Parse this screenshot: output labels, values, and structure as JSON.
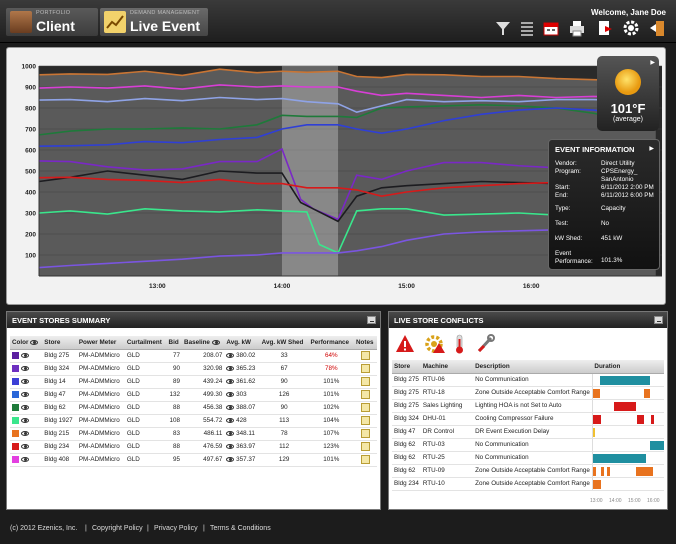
{
  "header": {
    "crumb1": {
      "small": "PORTFOLIO",
      "big": "Client"
    },
    "crumb2": {
      "small": "DEMAND MANAGEMENT",
      "big": "Live Event"
    },
    "welcome": "Welcome, Jane Doe",
    "tools": [
      "filter-icon",
      "table-icon",
      "calendar-icon",
      "print-icon",
      "export-icon",
      "gear-icon",
      "logout-icon"
    ]
  },
  "weather": {
    "temp": "101°F",
    "label": "(average)"
  },
  "event_info": {
    "title": "EVENT INFORMATION",
    "rows": [
      {
        "label": "Vendor:",
        "value": "Direct Utility"
      },
      {
        "label": "Program:",
        "value": "CPSEnergy_ SanAntonio"
      },
      {
        "label": "Start:",
        "value": "6/11/2012 2:00 PM"
      },
      {
        "label": "End:",
        "value": "6/11/2012 6:00 PM"
      },
      {
        "label": "Type:",
        "value": "Capacity"
      },
      {
        "label": "Test:",
        "value": "No"
      },
      {
        "label": "kW Shed:",
        "value": "451 kW"
      },
      {
        "label": "Event Performance:",
        "value": "101.3%"
      }
    ]
  },
  "chart_data": {
    "type": "line",
    "ylim": [
      0,
      1000
    ],
    "yticks": [
      "1000",
      "900",
      "800",
      "700",
      "600",
      "500",
      "400",
      "300",
      "200",
      "100"
    ],
    "xticks": [
      "13:00",
      "14:00",
      "15:00",
      "16:00"
    ],
    "xlim": [
      12.05,
      17.05
    ],
    "event_window": [
      14.0,
      14.45
    ],
    "series": [
      {
        "color": "#c97534",
        "x": [
          12.05,
          12.3,
          12.6,
          12.9,
          13.2,
          13.5,
          13.8,
          14.0,
          14.2,
          14.45,
          14.6,
          14.8,
          15.0,
          15.3,
          15.6,
          15.9,
          16.2,
          16.5,
          16.8,
          17.0
        ],
        "values": [
          958,
          962,
          960,
          975,
          955,
          985,
          968,
          975,
          970,
          975,
          950,
          945,
          960,
          958,
          950,
          950,
          940,
          935,
          930,
          935
        ]
      },
      {
        "color": "#d83fd6",
        "x": [
          12.05,
          12.3,
          12.6,
          12.9,
          13.2,
          13.5,
          13.8,
          14.0,
          14.2,
          14.45,
          14.6,
          14.8,
          15.0,
          15.3,
          15.6,
          15.9,
          16.2,
          16.5,
          16.8,
          17.0
        ],
        "values": [
          895,
          900,
          895,
          905,
          890,
          910,
          900,
          905,
          900,
          900,
          880,
          860,
          870,
          860,
          850,
          860,
          850,
          855,
          850,
          870
        ]
      },
      {
        "color": "#8fa3e6",
        "x": [
          12.05,
          12.3,
          12.6,
          12.9,
          13.2,
          13.5,
          13.8,
          14.0,
          14.2,
          14.45,
          14.6,
          14.8,
          15.0,
          15.3,
          15.6,
          15.9,
          16.2,
          16.5,
          16.8,
          17.0
        ],
        "values": [
          838,
          840,
          830,
          845,
          835,
          850,
          840,
          845,
          830,
          820,
          780,
          810,
          840,
          830,
          835,
          830,
          840,
          840,
          835,
          840
        ]
      },
      {
        "color": "#1e7a3a",
        "x": [
          12.05,
          12.3,
          12.6,
          12.9,
          13.2,
          13.5,
          13.8,
          14.0,
          14.2,
          14.45,
          14.6,
          14.8,
          15.0,
          15.3,
          15.6,
          15.9,
          16.2,
          16.5,
          16.8,
          17.0
        ],
        "values": [
          672,
          690,
          700,
          700,
          705,
          700,
          720,
          765,
          760,
          760,
          755,
          800,
          805,
          810,
          815,
          810,
          800,
          775,
          740,
          700
        ]
      },
      {
        "color": "#2f3fd6",
        "x": [
          12.05,
          12.3,
          12.6,
          12.9,
          13.2,
          13.5,
          13.8,
          14.0,
          14.2,
          14.45,
          14.6,
          14.8,
          15.0,
          15.3,
          15.6,
          15.9,
          16.2,
          16.5,
          16.8,
          17.0
        ],
        "values": [
          618,
          620,
          625,
          640,
          635,
          650,
          660,
          700,
          720,
          720,
          700,
          680,
          700,
          740,
          770,
          790,
          800,
          790,
          770,
          770
        ]
      },
      {
        "color": "#7a28c6",
        "x": [
          12.05,
          12.3,
          12.6,
          12.9,
          13.2,
          13.5,
          13.8,
          14.0,
          14.15,
          14.25,
          14.45,
          14.6,
          14.8,
          15.0,
          15.3,
          15.6,
          15.9,
          16.2,
          16.5,
          16.8,
          17.0
        ],
        "values": [
          548,
          545,
          520,
          505,
          510,
          545,
          545,
          605,
          365,
          320,
          270,
          480,
          460,
          500,
          540,
          540,
          525,
          515,
          510,
          500,
          520
        ]
      },
      {
        "color": "#1c1c20",
        "x": [
          12.05,
          12.3,
          12.6,
          12.9,
          13.2,
          13.5,
          13.8,
          14.0,
          14.15,
          14.25,
          14.45,
          14.6,
          14.8,
          15.0,
          15.3,
          15.6,
          15.9,
          16.2,
          16.5,
          16.8,
          17.0
        ],
        "values": [
          450,
          470,
          500,
          480,
          460,
          500,
          490,
          490,
          350,
          320,
          260,
          380,
          420,
          430,
          440,
          450,
          445,
          440,
          430,
          430,
          440
        ]
      },
      {
        "color": "#d71a1a",
        "x": [
          12.05,
          12.3,
          12.6,
          12.9,
          13.2,
          13.5,
          13.8,
          14.0,
          14.2,
          14.45,
          14.6,
          14.8,
          15.0,
          15.3,
          15.6,
          15.9,
          16.2,
          16.5,
          16.8,
          17.0
        ],
        "values": [
          468,
          470,
          460,
          455,
          445,
          460,
          440,
          440,
          420,
          420,
          410,
          380,
          400,
          420,
          430,
          440,
          445,
          440,
          430,
          420
        ]
      },
      {
        "color": "#3ae68c",
        "x": [
          12.05,
          12.3,
          12.6,
          12.9,
          13.2,
          13.5,
          13.8,
          14.0,
          14.2,
          14.3,
          14.45,
          14.6,
          14.8,
          15.0,
          15.3,
          15.6,
          15.9,
          16.2,
          16.5,
          16.8,
          17.0
        ],
        "values": [
          300,
          310,
          295,
          320,
          310,
          305,
          315,
          310,
          305,
          150,
          110,
          310,
          320,
          320,
          290,
          295,
          300,
          290,
          295,
          300,
          305
        ]
      },
      {
        "color": "#7a55e0",
        "x": [
          12.05,
          12.3,
          12.6,
          12.9,
          13.2,
          13.5,
          13.8,
          14.0,
          14.2,
          14.45,
          14.6,
          14.8,
          15.0,
          15.3,
          15.6,
          15.9,
          16.2,
          16.5,
          16.8,
          17.0
        ],
        "values": [
          40,
          50,
          60,
          70,
          80,
          95,
          100,
          110,
          110,
          110,
          120,
          140,
          170,
          200,
          210,
          215,
          220,
          215,
          220,
          235
        ]
      }
    ]
  },
  "event_stores": {
    "title": "EVENT STORES SUMMARY",
    "columns": [
      "Color",
      "Store",
      "Power Meter",
      "Curtailment",
      "Bid",
      "Baseline",
      "Avg. kW",
      "Avg. kW Shed",
      "Performance",
      "Notes"
    ],
    "rows": [
      {
        "color": "#5b1fa0",
        "store": "Bldg 275",
        "meter": "PM-ADMMicro",
        "curt": "GLD",
        "bid": "77",
        "baseline": "208.07",
        "avg": "380.02",
        "shed": "33",
        "perf": "64%",
        "low": true
      },
      {
        "color": "#6d2fc0",
        "store": "Bldg 324",
        "meter": "PM-ADMMicro",
        "curt": "GLD",
        "bid": "90",
        "baseline": "320.98",
        "avg": "365.23",
        "shed": "67",
        "perf": "78%",
        "low": true
      },
      {
        "color": "#3b3fd6",
        "store": "Bldg 14",
        "meter": "PM-ADMMicro",
        "curt": "GLD",
        "bid": "89",
        "baseline": "439.24",
        "avg": "361.62",
        "shed": "90",
        "perf": "101%",
        "low": false
      },
      {
        "color": "#2a66d8",
        "store": "Bldg 47",
        "meter": "PM-ADMMicro",
        "curt": "GLD",
        "bid": "132",
        "baseline": "499.30",
        "avg": "303",
        "shed": "126",
        "perf": "101%",
        "low": false
      },
      {
        "color": "#1e7a3a",
        "store": "Bldg 62",
        "meter": "PM-ADMMicro",
        "curt": "GLD",
        "bid": "88",
        "baseline": "456.38",
        "avg": "388.07",
        "shed": "90",
        "perf": "102%",
        "low": false
      },
      {
        "color": "#3ae68c",
        "store": "Bldg 1927",
        "meter": "PM-ADMMicro",
        "curt": "GLD",
        "bid": "108",
        "baseline": "554.72",
        "avg": "428",
        "shed": "113",
        "perf": "104%",
        "low": false
      },
      {
        "color": "#e8731f",
        "store": "Bldg 215",
        "meter": "PM-ADMMicro",
        "curt": "GLD",
        "bid": "83",
        "baseline": "486.11",
        "avg": "348.11",
        "shed": "78",
        "perf": "107%",
        "low": false
      },
      {
        "color": "#d71a1a",
        "store": "Bldg 234",
        "meter": "PM-ADMMicro",
        "curt": "GLD",
        "bid": "88",
        "baseline": "476.59",
        "avg": "363.97",
        "shed": "112",
        "perf": "123%",
        "low": false
      },
      {
        "color": "#e33fe0",
        "store": "Bldg 408",
        "meter": "PM-ADMMicro",
        "curt": "GLD",
        "bid": "95",
        "baseline": "497.67",
        "avg": "357.37",
        "shed": "129",
        "perf": "101%",
        "low": false
      }
    ]
  },
  "conflicts": {
    "title": "LIVE STORE CONFLICTS",
    "icons": [
      "warning-icon",
      "gear-warning-icon",
      "thermometer-icon",
      "wrench-icon"
    ],
    "columns": [
      "Store",
      "Machine",
      "Description",
      "Duration"
    ],
    "time_ticks": [
      "13:00",
      "14:00",
      "15:00",
      "16:00"
    ],
    "rows": [
      {
        "store": "Bldg 275",
        "machine": "RTU-06",
        "desc": "No Communication",
        "bars": [
          {
            "s": 0.1,
            "e": 0.8,
            "c": "#1f8fa0"
          }
        ]
      },
      {
        "store": "Bldg 275",
        "machine": "RTU-18",
        "desc": "Zone Outside Acceptable Comfort Range",
        "bars": [
          {
            "s": 0.0,
            "e": 0.1,
            "c": "#e8731f"
          },
          {
            "s": 0.72,
            "e": 0.8,
            "c": "#e8731f"
          }
        ]
      },
      {
        "store": "Bldg 275",
        "machine": "Sales Lighting",
        "desc": "Lighting HOA is not Set to Auto",
        "bars": [
          {
            "s": 0.3,
            "e": 0.6,
            "c": "#d71a1a"
          }
        ]
      },
      {
        "store": "Bldg 324",
        "machine": "DHU-01",
        "desc": "Cooling Compressor Failure",
        "bars": [
          {
            "s": 0.0,
            "e": 0.12,
            "c": "#d71a1a"
          },
          {
            "s": 0.62,
            "e": 0.72,
            "c": "#d71a1a"
          },
          {
            "s": 0.82,
            "e": 0.86,
            "c": "#d71a1a"
          }
        ]
      },
      {
        "store": "Bldg 47",
        "machine": "DR Control",
        "desc": "DR Event Execution Delay",
        "bars": [
          {
            "s": 0.0,
            "e": 0.03,
            "c": "#f0c030"
          }
        ]
      },
      {
        "store": "Bldg 62",
        "machine": "RTU-03",
        "desc": "No Communication",
        "bars": [
          {
            "s": 0.8,
            "e": 1.0,
            "c": "#1f8fa0"
          }
        ]
      },
      {
        "store": "Bldg 62",
        "machine": "RTU-25",
        "desc": "No Communication",
        "bars": [
          {
            "s": 0.0,
            "e": 0.75,
            "c": "#1f8fa0"
          }
        ]
      },
      {
        "store": "Bldg 62",
        "machine": "RTU-09",
        "desc": "Zone Outside Acceptable Comfort Range",
        "bars": [
          {
            "s": 0.0,
            "e": 0.04,
            "c": "#e8731f"
          },
          {
            "s": 0.12,
            "e": 0.16,
            "c": "#e8731f"
          },
          {
            "s": 0.2,
            "e": 0.24,
            "c": "#e8731f"
          },
          {
            "s": 0.6,
            "e": 0.85,
            "c": "#e8731f"
          }
        ]
      },
      {
        "store": "Bldg 234",
        "machine": "RTU-10",
        "desc": "Zone Outside Acceptable Comfort Range",
        "bars": [
          {
            "s": 0.0,
            "e": 0.12,
            "c": "#e8731f"
          }
        ]
      }
    ]
  },
  "footer": {
    "copyright": "(c) 2012 Ezenics, Inc.",
    "links": [
      "Copyright Policy",
      "Privacy Policy",
      "Terms & Conditions"
    ]
  }
}
